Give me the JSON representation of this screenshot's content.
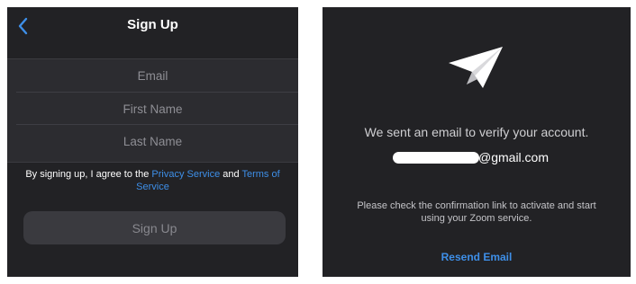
{
  "signup_screen": {
    "title": "Sign Up",
    "back_icon": "chevron-left-icon",
    "accent_color": "#3e8fe8",
    "fields": {
      "email": {
        "placeholder": "Email",
        "value": ""
      },
      "first_name": {
        "placeholder": "First Name",
        "value": ""
      },
      "last_name": {
        "placeholder": "Last Name",
        "value": ""
      }
    },
    "terms": {
      "prefix": "By signing up, I agree to the ",
      "privacy_link": "Privacy Service",
      "conjunction": " and ",
      "terms_link": "Terms of Service"
    },
    "signup_button_label": "Sign Up"
  },
  "verify_screen": {
    "icon": "paper-plane-icon",
    "message": "We sent an email to verify your account.",
    "email_domain": "@gmail.com",
    "instructions_line1": "Please check the confirmation link to activate and start",
    "instructions_line2": "using your Zoom service.",
    "resend_label": "Resend Email"
  }
}
